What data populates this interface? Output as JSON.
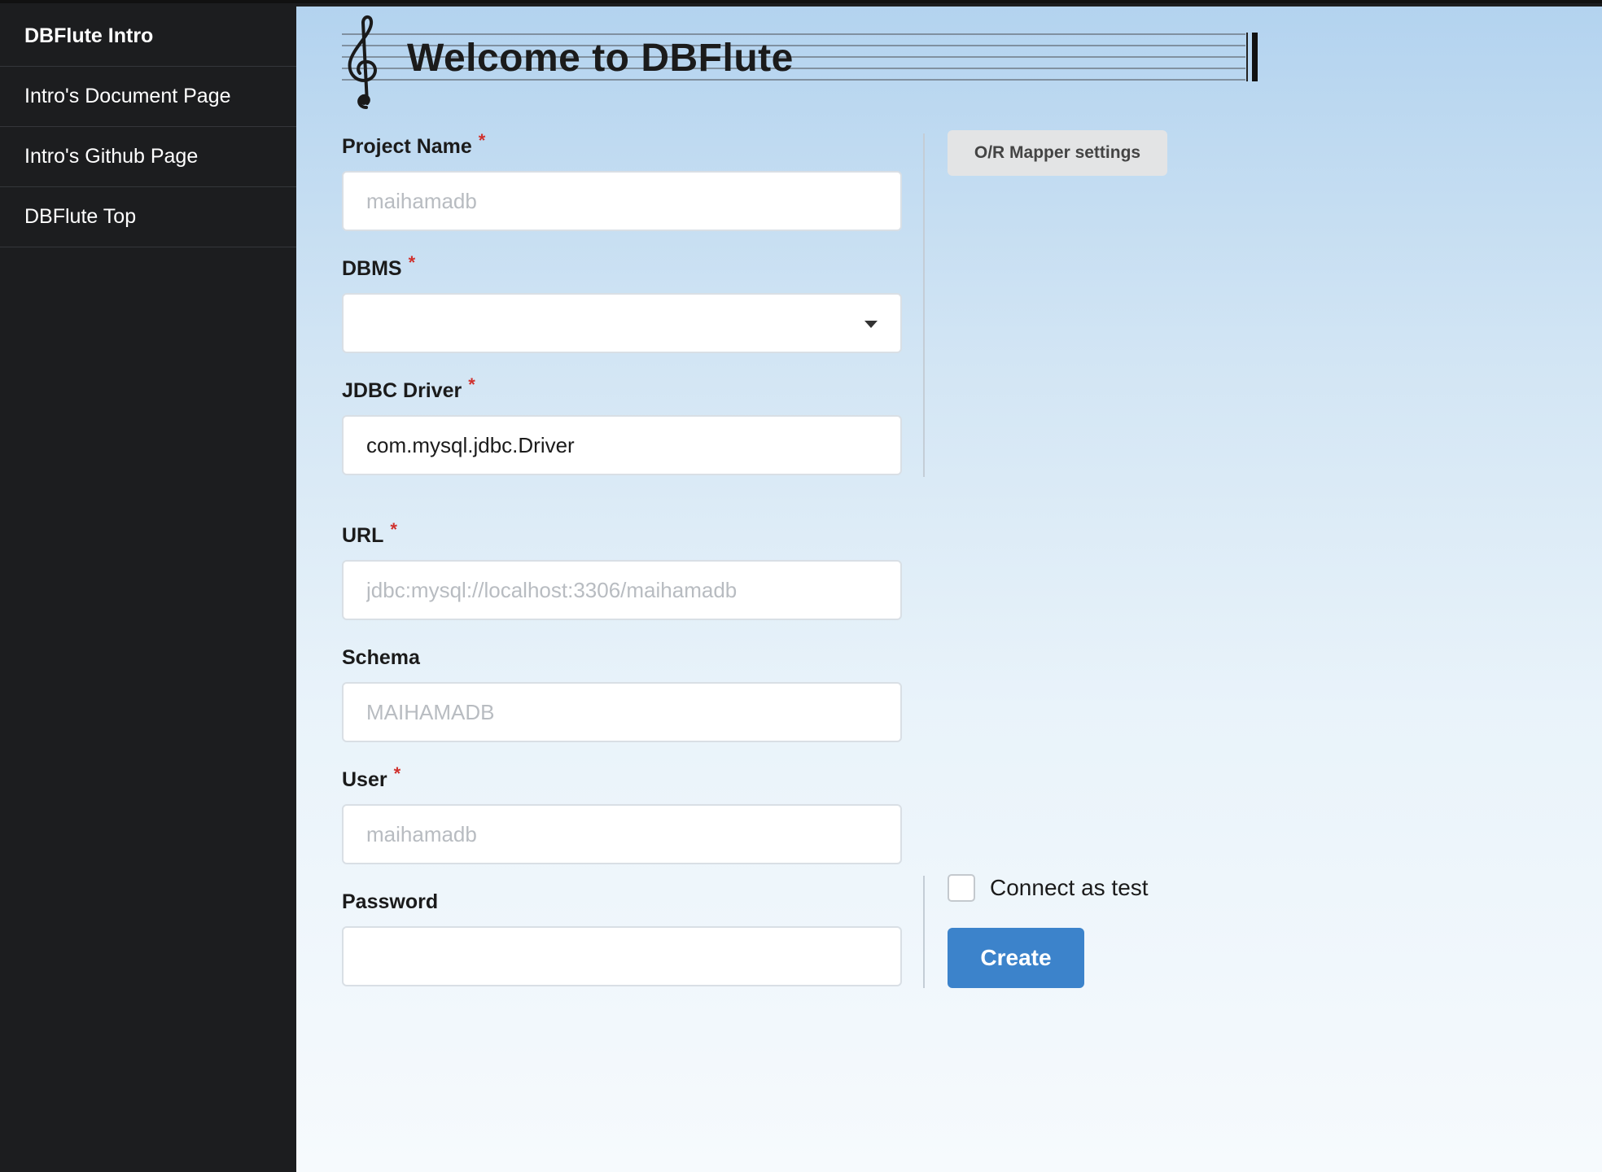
{
  "sidebar": {
    "items": [
      {
        "label": "DBFlute Intro"
      },
      {
        "label": "Intro's Document Page"
      },
      {
        "label": "Intro's Github Page"
      },
      {
        "label": "DBFlute Top"
      }
    ]
  },
  "header": {
    "title": "Welcome to DBFlute",
    "icon": "treble-clef-icon"
  },
  "form": {
    "project_name": {
      "label": "Project Name",
      "required_mark": "*",
      "placeholder": "maihamadb",
      "value": ""
    },
    "dbms": {
      "label": "DBMS",
      "required_mark": "*",
      "value": ""
    },
    "jdbc_driver": {
      "label": "JDBC Driver",
      "required_mark": "*",
      "placeholder": "",
      "value": "com.mysql.jdbc.Driver"
    },
    "url": {
      "label": "URL",
      "required_mark": "*",
      "placeholder": "jdbc:mysql://localhost:3306/maihamadb",
      "value": ""
    },
    "schema": {
      "label": "Schema",
      "placeholder": "MAIHAMADB",
      "value": ""
    },
    "user": {
      "label": "User",
      "required_mark": "*",
      "placeholder": "maihamadb",
      "value": ""
    },
    "password": {
      "label": "Password",
      "placeholder": "",
      "value": ""
    }
  },
  "side_panel": {
    "orm_button": "O/R Mapper settings",
    "connect_test_label": "Connect as test",
    "connect_test_checked": false,
    "create_button": "Create"
  },
  "colors": {
    "sidebar_bg": "#1c1d1f",
    "primary_button": "#3c83cb",
    "required": "#d0312d"
  }
}
